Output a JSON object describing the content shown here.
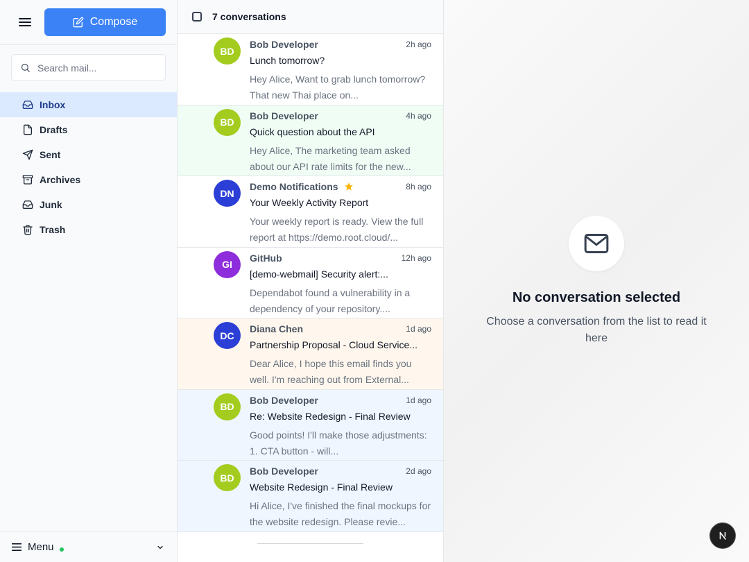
{
  "sidebar": {
    "compose_label": "Compose",
    "search_placeholder": "Search mail...",
    "nav": [
      {
        "label": "Inbox",
        "icon": "inbox-icon",
        "active": true
      },
      {
        "label": "Drafts",
        "icon": "file-icon"
      },
      {
        "label": "Sent",
        "icon": "send-icon"
      },
      {
        "label": "Archives",
        "icon": "archive-icon"
      },
      {
        "label": "Junk",
        "icon": "junk-icon"
      },
      {
        "label": "Trash",
        "icon": "trash-icon"
      }
    ],
    "menu_label": "Menu",
    "status_color": "#22c55e"
  },
  "list": {
    "count_label": "7 conversations",
    "conversations": [
      {
        "initials": "BD",
        "avatar_color": "#a3cc1f",
        "sender": "Bob Developer",
        "time": "2h ago",
        "subject": "Lunch tomorrow?",
        "preview": "Hey Alice, Want to grab lunch tomorrow? That new Thai place on...",
        "tint": "none"
      },
      {
        "initials": "BD",
        "avatar_color": "#a3cc1f",
        "sender": "Bob Developer",
        "time": "4h ago",
        "subject": "Quick question about the API",
        "preview": "Hey Alice, The marketing team asked about our API rate limits for the new...",
        "tint": "green"
      },
      {
        "initials": "DN",
        "avatar_color": "#2b3fd6",
        "sender": "Demo Notifications",
        "time": "8h ago",
        "subject": "Your Weekly Activity Report",
        "preview": "Your weekly report is ready. View the full report at https://demo.root.cloud/...",
        "tint": "none",
        "starred": true
      },
      {
        "initials": "GI",
        "avatar_color": "#8e2ddb",
        "sender": "GitHub",
        "time": "12h ago",
        "subject": "[demo-webmail] Security alert:...",
        "preview": "Dependabot found a vulnerability in a dependency of your repository....",
        "tint": "none"
      },
      {
        "initials": "DC",
        "avatar_color": "#2b3fd6",
        "sender": "Diana Chen",
        "time": "1d ago",
        "subject": "Partnership Proposal - Cloud Service...",
        "preview": "Dear Alice, I hope this email finds you well. I'm reaching out from External...",
        "tint": "orange"
      },
      {
        "initials": "BD",
        "avatar_color": "#a3cc1f",
        "sender": "Bob Developer",
        "time": "1d ago",
        "subject": "Re: Website Redesign - Final Review",
        "preview": "Good points! I'll make those adjustments: 1. CTA button - will...",
        "tint": "blue"
      },
      {
        "initials": "BD",
        "avatar_color": "#a3cc1f",
        "sender": "Bob Developer",
        "time": "2d ago",
        "subject": "Website Redesign - Final Review",
        "preview": "Hi Alice, I've finished the final mockups for the website redesign. Please revie...",
        "tint": "blue"
      }
    ]
  },
  "detail": {
    "empty_title": "No conversation selected",
    "empty_subtitle": "Choose a conversation from the list to read it here",
    "empty_icon": "mail-icon"
  },
  "fab_icon": "nextjs-logo-icon",
  "colors": {
    "accent": "#3b82f6",
    "active_nav_bg": "#dbeafe",
    "star": "#f5b301"
  }
}
